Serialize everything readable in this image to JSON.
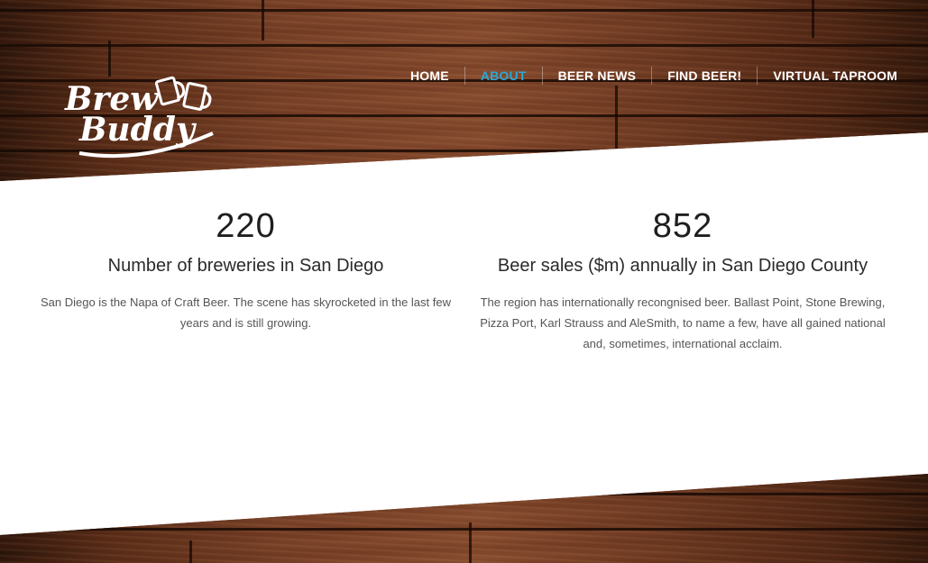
{
  "brand": {
    "logo_text_line1": "Brew",
    "logo_text_line2": "Buddy"
  },
  "nav": {
    "items": [
      {
        "label": "HOME",
        "active": false
      },
      {
        "label": "ABOUT",
        "active": true
      },
      {
        "label": "BEER NEWS",
        "active": false
      },
      {
        "label": "FIND BEER!",
        "active": false
      },
      {
        "label": "VIRTUAL TAPROOM",
        "active": false
      }
    ],
    "active_color": "#29a9d9"
  },
  "stats": [
    {
      "number": "220",
      "title": "Number of breweries in San Diego",
      "description": "San Diego is the Napa of Craft Beer. The scene has skyrocketed in the last few years and is still growing."
    },
    {
      "number": "852",
      "title": "Beer sales ($m) annually in San Diego County",
      "description": "The region has internationally recongnised beer. Ballast Point, Stone Brewing, Pizza Port, Karl Strauss and AleSmith, to name a few, have all gained national and, sometimes, international acclaim."
    }
  ]
}
